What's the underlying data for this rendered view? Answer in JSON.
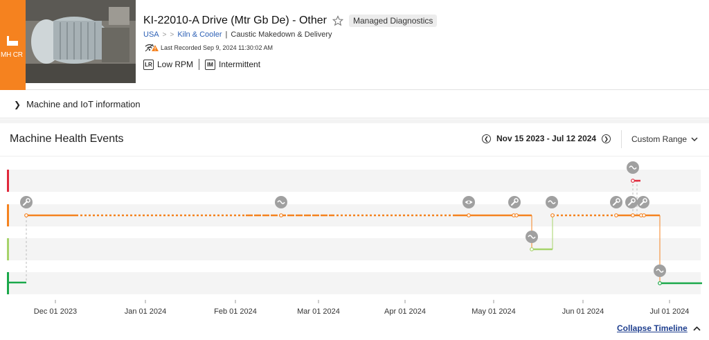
{
  "header": {
    "badge_label": "MH CR",
    "title": "KI-22010-A Drive (Mtr Gb De) - Other",
    "chip": "Managed Diagnostics",
    "breadcrumb": {
      "country": "USA",
      "sep": ">",
      "area": "Kiln & Cooler",
      "bar": "|",
      "location": "Caustic Makedown & Delivery"
    },
    "last_recorded": "Last Recorded Sep 9, 2024 11:30:02 AM",
    "tags": [
      {
        "code": "LR",
        "label": "Low RPM"
      },
      {
        "code": "IM",
        "label": "Intermittent"
      }
    ]
  },
  "machine_info": {
    "label": "Machine and IoT information"
  },
  "events": {
    "title": "Machine Health Events",
    "range": "Nov 15 2023 - Jul 12 2024",
    "custom_range": "Custom Range",
    "collapse_label": "Collapse Timeline"
  },
  "timeline": {
    "x_labels": [
      "Dec 01 2023",
      "Jan 01 2024",
      "Feb 01 2024",
      "Mar 01 2024",
      "Apr 01 2024",
      "May 01 2024",
      "Jun 01 2024",
      "Jul 01 2024"
    ],
    "lanes": [
      {
        "name": "critical",
        "color": "#e0283b"
      },
      {
        "name": "warning",
        "color": "#f5821f"
      },
      {
        "name": "caution",
        "color": "#a6d36a"
      },
      {
        "name": "healthy",
        "color": "#1aa84a"
      }
    ],
    "events": [
      {
        "type": "wrench-icon",
        "date": "Nov 26 2023"
      },
      {
        "type": "wave-icon",
        "date": "Feb 19 2024"
      },
      {
        "type": "eye-icon",
        "date": "Apr 24 2024"
      },
      {
        "type": "wrench-icon",
        "date": "May 09 2024"
      },
      {
        "type": "wave-icon",
        "date": "May 22 2024"
      },
      {
        "type": "wave-icon",
        "date": "May 29 2024"
      },
      {
        "type": "wrench-icon",
        "date": "Jun 12 2024"
      },
      {
        "type": "wrench-icon",
        "date": "Jun 17 2024"
      },
      {
        "type": "wrench-icon",
        "date": "Jun 19 2024"
      },
      {
        "type": "wave-icon",
        "date": "Jun 18 2024"
      },
      {
        "type": "wave-icon",
        "date": "Jun 26 2024"
      }
    ]
  }
}
